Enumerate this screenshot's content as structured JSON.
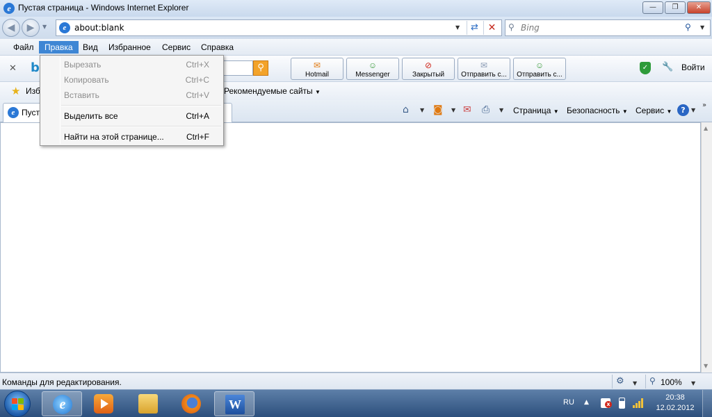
{
  "window": {
    "title": "Пустая страница - Windows Internet Explorer",
    "controls": {
      "minimize": "—",
      "maximize": "❐",
      "close": "✕"
    }
  },
  "address_bar": {
    "url": "about:blank",
    "search_placeholder": "Bing"
  },
  "menu": {
    "items": [
      "Файл",
      "Правка",
      "Вид",
      "Избранное",
      "Сервис",
      "Справка"
    ],
    "active": "Правка"
  },
  "toolbar": {
    "quick_buttons": [
      "Hotmail",
      "Messenger",
      "Закрытый",
      "Отправить с...",
      "Отправить с..."
    ],
    "login": "Войти"
  },
  "favorites_bar": {
    "label": "Изб",
    "recommended": "Рекомендуемые сайты"
  },
  "tab": {
    "label": "Пуст"
  },
  "command_bar": {
    "page": "Страница",
    "safety": "Безопасность",
    "tools": "Сервис"
  },
  "edit_menu": {
    "items": [
      {
        "label": "Вырезать",
        "shortcut": "Ctrl+X",
        "enabled": false
      },
      {
        "label": "Копировать",
        "shortcut": "Ctrl+C",
        "enabled": false
      },
      {
        "label": "Вставить",
        "shortcut": "Ctrl+V",
        "enabled": false
      },
      {
        "label": "Выделить все",
        "shortcut": "Ctrl+A",
        "enabled": true
      },
      {
        "label": "Найти на этой странице...",
        "shortcut": "Ctrl+F",
        "enabled": true
      }
    ]
  },
  "status_bar": {
    "text": "Команды для редактирования.",
    "zoom": "100%"
  },
  "taskbar": {
    "language": "RU",
    "time": "20:38",
    "date": "12.02.2012"
  },
  "icons": {
    "ie": "ie-logo-icon",
    "search": "magnifier-icon",
    "shield": "shield-icon",
    "help": "help-icon"
  },
  "colors": {
    "menu_highlight": "#3e86d4",
    "disabled_text": "#8d8d8d",
    "close_button": "#c7422b"
  }
}
